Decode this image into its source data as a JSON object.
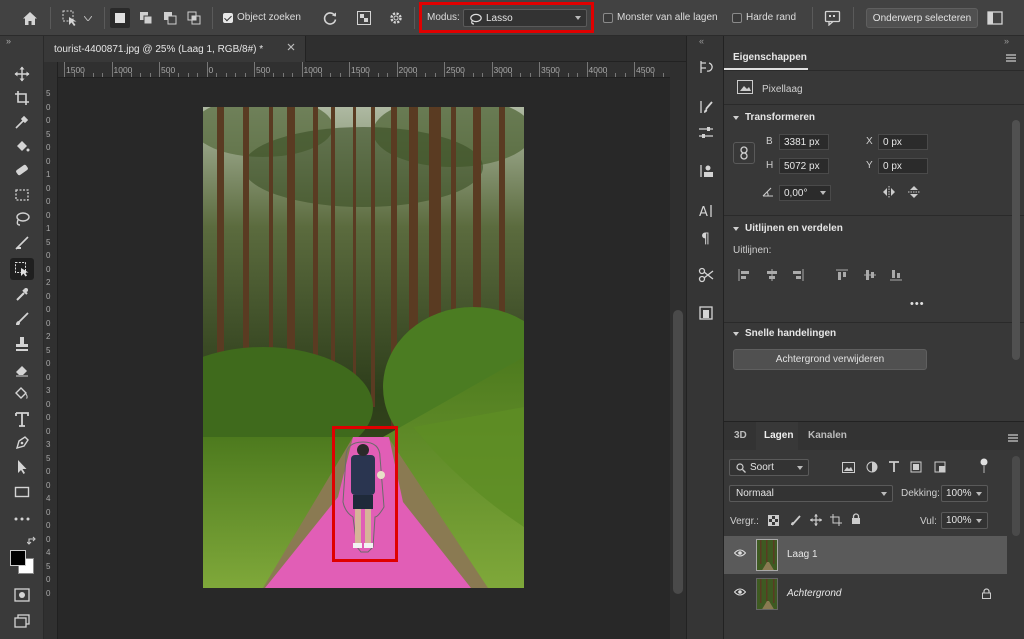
{
  "options_bar": {
    "object_search_label": "Object zoeken",
    "mode_label": "Modus:",
    "mode_value": "Lasso",
    "sample_all_layers_label": "Monster van alle lagen",
    "hard_edge_label": "Harde rand",
    "select_subject_label": "Onderwerp selecteren"
  },
  "document": {
    "tab_title": "tourist-4400871.jpg @ 25% (Laag 1, RGB/8#) *",
    "ruler_h_labels": [
      "1500",
      "1000",
      "500",
      "0",
      "500",
      "1000",
      "1500",
      "2000",
      "2500",
      "3000",
      "3500",
      "4000",
      "4500"
    ],
    "ruler_v_labels": [
      "5",
      "0",
      "0",
      "5",
      "0",
      "0",
      "1",
      "0",
      "0",
      "0",
      "1",
      "5",
      "0",
      "0",
      "2",
      "0",
      "0",
      "0",
      "2",
      "5",
      "0",
      "0",
      "3",
      "0",
      "0",
      "0",
      "3",
      "5",
      "0",
      "0",
      "4",
      "0",
      "0",
      "0",
      "4",
      "5",
      "0",
      "0"
    ]
  },
  "properties": {
    "tab_label": "Eigenschappen",
    "layer_kind": "Pixellaag",
    "transform_title": "Transformeren",
    "w_label": "B",
    "w_value": "3381 px",
    "h_label": "H",
    "h_value": "5072 px",
    "x_label": "X",
    "x_value": "0 px",
    "y_label": "Y",
    "y_value": "0 px",
    "angle_value": "0,00°",
    "align_title": "Uitlijnen en verdelen",
    "align_label": "Uitlijnen:",
    "more_label": "•••",
    "quick_actions_title": "Snelle handelingen",
    "remove_bg_label": "Achtergrond verwijderen"
  },
  "layers_panel": {
    "tabs": [
      "3D",
      "Lagen",
      "Kanalen"
    ],
    "active_tab": "Lagen",
    "filter_label": "Soort",
    "blend_mode": "Normaal",
    "opacity_label": "Dekking:",
    "opacity_value": "100%",
    "lock_label": "Vergr.:",
    "fill_label": "Vul:",
    "fill_value": "100%",
    "layers": [
      {
        "name": "Laag 1",
        "selected": true,
        "italic": false
      },
      {
        "name": "Achtergrond",
        "selected": false,
        "italic": true
      }
    ]
  },
  "colors": {
    "highlight_red": "#e00000",
    "selection_pink": "#e85bbf",
    "panel_bg": "#383838"
  }
}
